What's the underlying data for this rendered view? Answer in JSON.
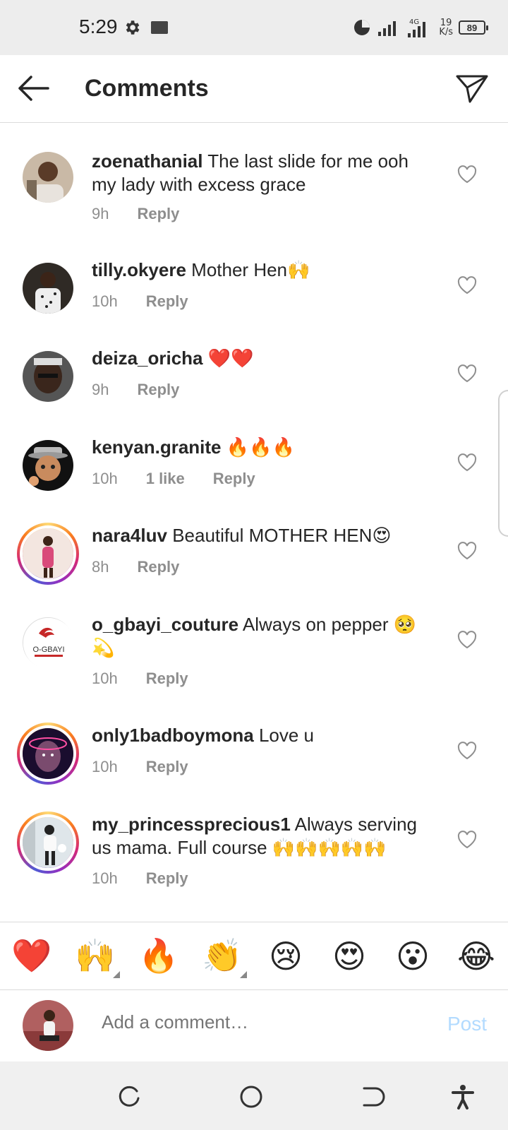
{
  "status_bar": {
    "time": "5:29",
    "network": "4G",
    "speed_value": "19",
    "speed_unit": "K/s",
    "battery": "89"
  },
  "header": {
    "title": "Comments"
  },
  "comments": [
    {
      "username": "zoenathanial",
      "text": "The last slide for me ooh my lady with excess grace",
      "time": "9h",
      "likes": "",
      "reply": "Reply"
    },
    {
      "username": "tilly.okyere",
      "text": "Mother Hen🙌",
      "time": "10h",
      "likes": "",
      "reply": "Reply"
    },
    {
      "username": "deiza_oricha",
      "text": "❤️❤️",
      "time": "9h",
      "likes": "",
      "reply": "Reply"
    },
    {
      "username": "kenyan.granite",
      "text": " 🔥🔥🔥",
      "time": "10h",
      "likes": "1 like",
      "reply": "Reply"
    },
    {
      "username": "nara4luv",
      "text": "Beautiful MOTHER HEN😍",
      "time": "8h",
      "likes": "",
      "reply": "Reply"
    },
    {
      "username": "o_gbayi_couture",
      "text": "Always on pepper 🥺💫",
      "time": "10h",
      "likes": "",
      "reply": "Reply",
      "avatar_text": "O-GBAYI"
    },
    {
      "username": "only1badboymona",
      "text": "Love u",
      "time": "10h",
      "likes": "",
      "reply": "Reply"
    },
    {
      "username": "my_princessprecious1",
      "text": "Always serving us mama.  Full course 🙌🙌🙌🙌🙌",
      "time": "10h",
      "likes": "",
      "reply": "Reply"
    }
  ],
  "emoji_bar": [
    "❤️",
    "🙌",
    "🔥",
    "👏",
    "😢",
    "😍",
    "😮",
    "😂"
  ],
  "compose": {
    "placeholder": "Add a comment…",
    "post_label": "Post"
  },
  "colors": {
    "post_disabled": "#b3dbff",
    "heart_red": "#ed4956",
    "meta_gray": "#8e8e8e"
  }
}
